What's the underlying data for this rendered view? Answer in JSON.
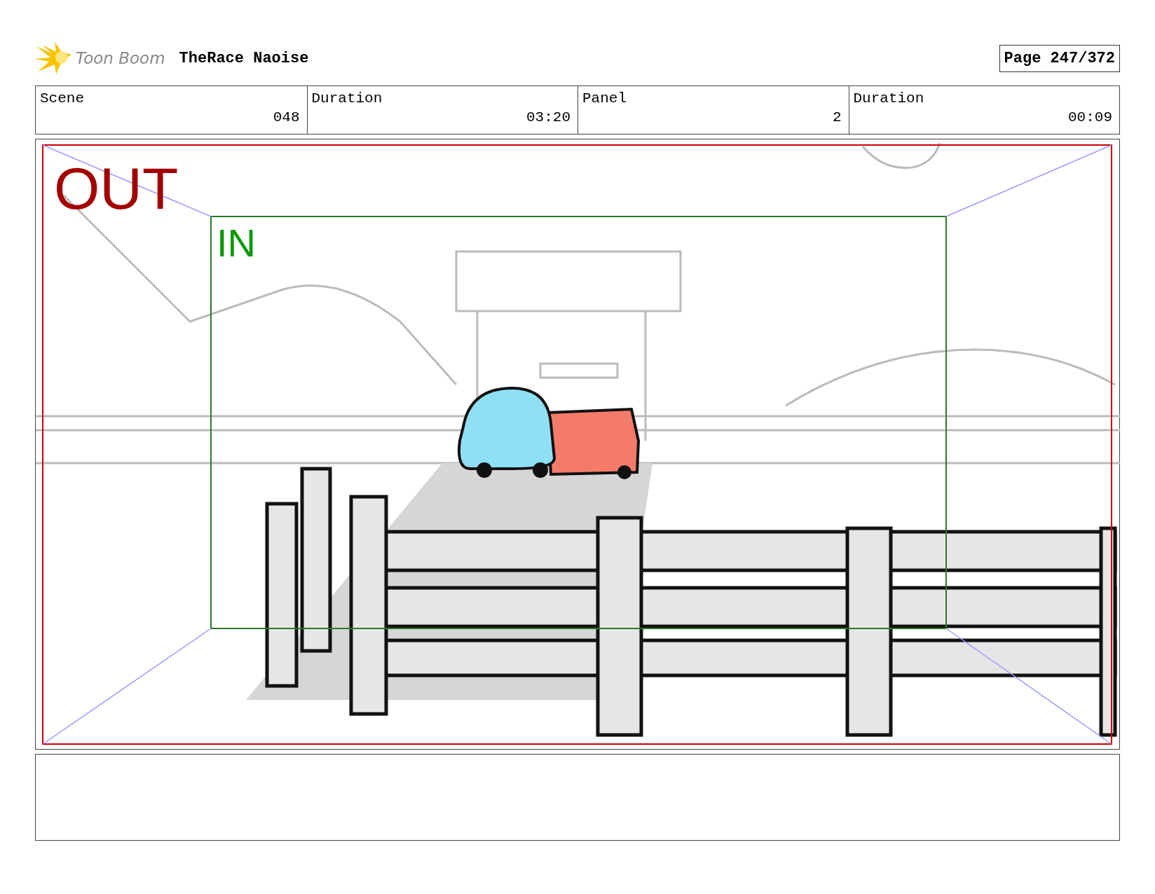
{
  "header": {
    "logo_text": "Toon Boom",
    "project": "TheRace Naoise",
    "page": "Page 247/372"
  },
  "info_table": {
    "columns": [
      "Scene",
      "Duration",
      "Panel",
      "Duration"
    ],
    "values": [
      "048",
      "03:20",
      "2",
      "00:09"
    ]
  },
  "panel": {
    "out_label": "OUT",
    "in_label": "IN"
  }
}
